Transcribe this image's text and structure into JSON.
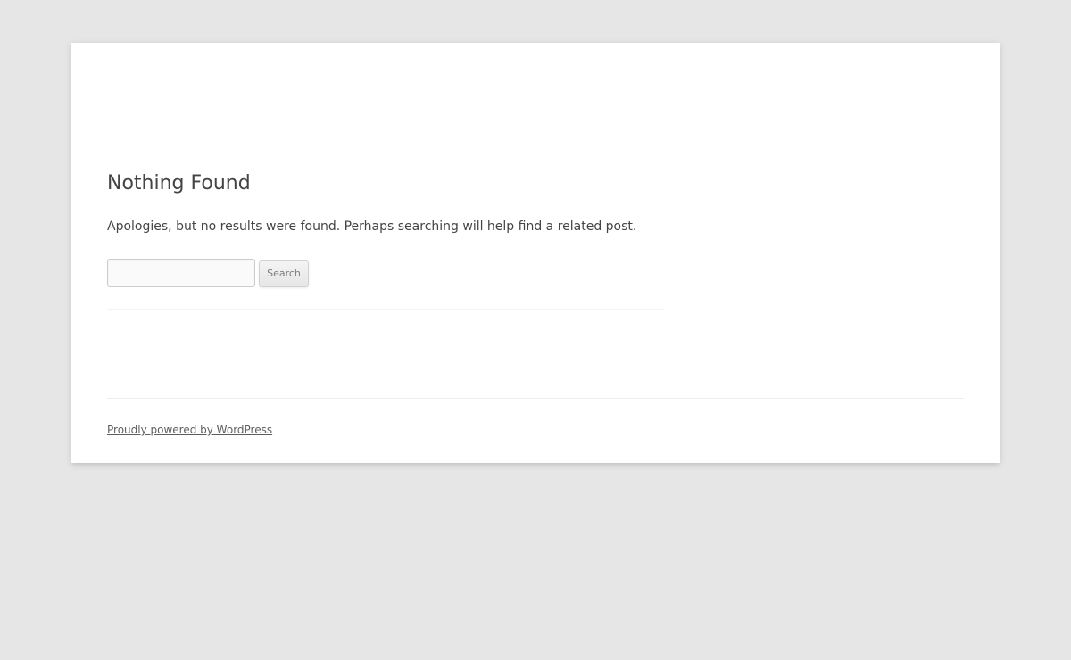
{
  "main": {
    "title": "Nothing Found",
    "message": "Apologies, but no results were found. Perhaps searching will help find a related post.",
    "search": {
      "value": "",
      "placeholder": "",
      "button_label": "Search"
    }
  },
  "footer": {
    "credit_link": "Proudly powered by WordPress"
  },
  "colors": {
    "background": "#e6e6e6",
    "page": "#ffffff",
    "text": "#444444",
    "link": "#5e5e5e",
    "button_text": "#7c7c7c"
  }
}
